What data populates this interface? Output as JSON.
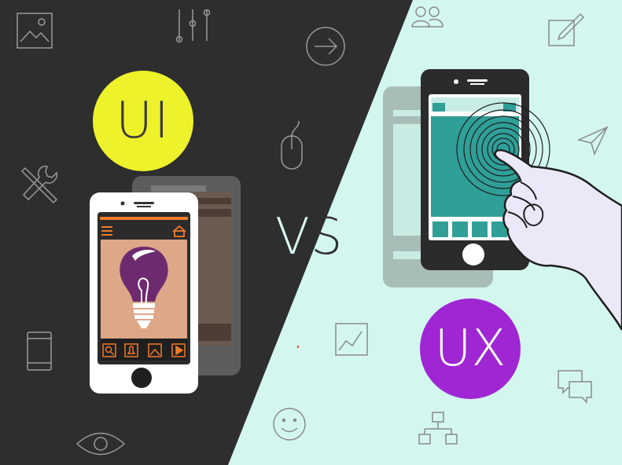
{
  "labels": {
    "ui": "UI",
    "vs_v": "V",
    "vs_s": "S",
    "ux": "UX"
  },
  "colors": {
    "dark_bg": "#2e2e2e",
    "light_bg": "#d3f7ef",
    "ui_circle": "#eef22a",
    "ux_circle": "#a026d4",
    "accent_orange": "#f07a2a",
    "screen_peach": "#dea787",
    "bulb_purple": "#6e2a6e",
    "teal_screen": "#2f9f98"
  },
  "icons": {
    "dark_side": [
      "image-icon",
      "sliders-icon",
      "arrow-right-circle-icon",
      "mouse-icon",
      "tools-icon",
      "tablet-icon",
      "eye-icon"
    ],
    "light_side": [
      "users-icon",
      "edit-icon",
      "send-icon",
      "chart-icon",
      "chat-icon",
      "smiley-icon",
      "sitemap-icon"
    ],
    "ui_phone_toolbar": [
      "search-icon",
      "bell-icon",
      "image-icon",
      "play-icon"
    ],
    "ui_phone_header": [
      "menu-icon",
      "home-icon"
    ]
  }
}
